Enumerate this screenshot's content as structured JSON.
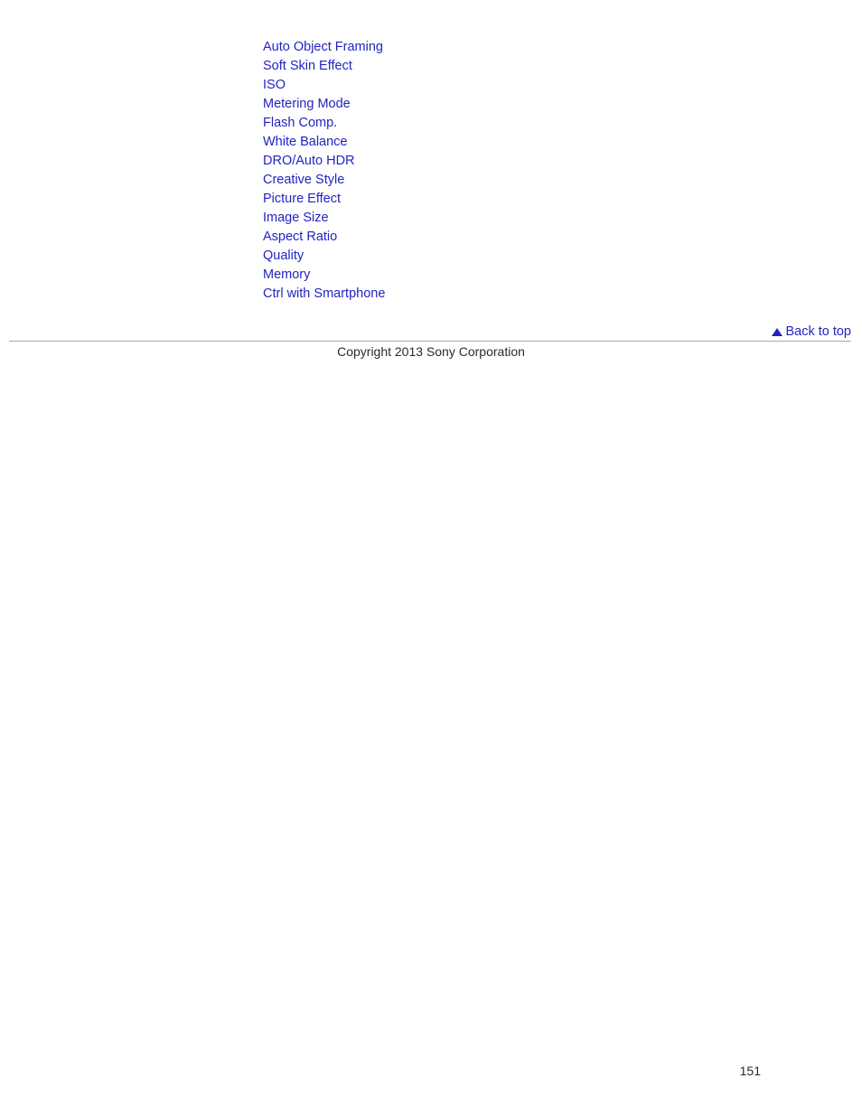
{
  "page": {
    "number": "151",
    "background_color": "#ffffff",
    "link_color": "#2323c4",
    "text_color": "#2b2b2b",
    "divider_color": "#a9a9a9"
  },
  "link_list": {
    "items": [
      {
        "label": "Auto Object Framing"
      },
      {
        "label": "Soft Skin Effect"
      },
      {
        "label": "ISO"
      },
      {
        "label": "Metering Mode"
      },
      {
        "label": "Flash Comp."
      },
      {
        "label": "White Balance"
      },
      {
        "label": "DRO/Auto HDR"
      },
      {
        "label": "Creative Style"
      },
      {
        "label": "Picture Effect"
      },
      {
        "label": "Image Size"
      },
      {
        "label": "Aspect Ratio"
      },
      {
        "label": "Quality"
      },
      {
        "label": "Memory"
      },
      {
        "label": "Ctrl with Smartphone"
      }
    ]
  },
  "footer": {
    "back_to_top_label": "Back to top",
    "back_to_top_icon": "triangle-up-icon",
    "copyright": "Copyright 2013 Sony Corporation"
  }
}
